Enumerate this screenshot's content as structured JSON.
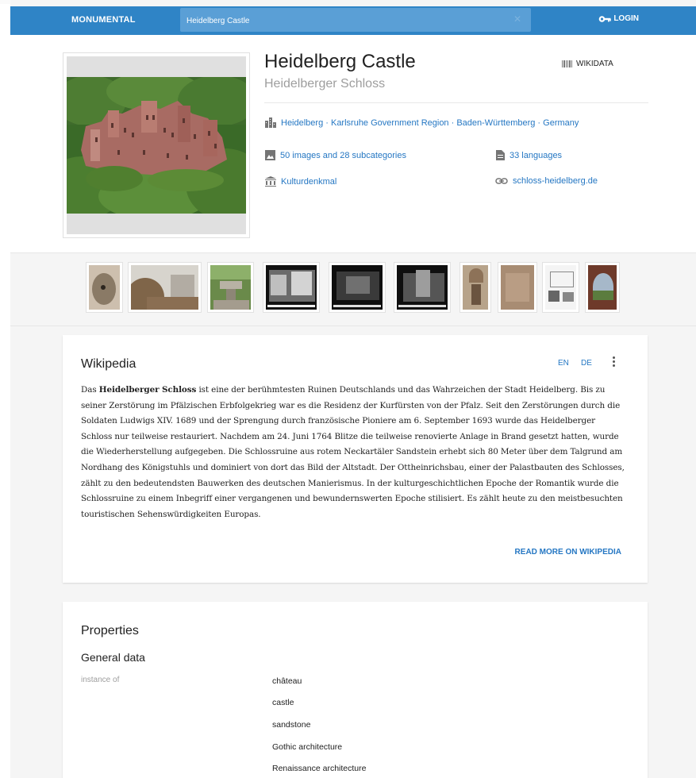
{
  "topbar": {
    "brand": "MONUMENTAL",
    "search_value": "Heidelberg Castle",
    "login_label": "LOGIN"
  },
  "monument": {
    "title": "Heidelberg Castle",
    "subtitle": "Heidelberger Schloss",
    "wikidata_label": "WIKIDATA",
    "location": "Heidelberg · Karlsruhe Government Region · Baden-Württemberg · Germany",
    "images": "50 images and 28 subcategories",
    "languages": "33 languages",
    "heritage": "Kulturdenkmal",
    "website": "schloss-heidelberg.de"
  },
  "thumbnails": [
    "thumb-1",
    "thumb-2",
    "thumb-3",
    "thumb-4",
    "thumb-5",
    "thumb-6",
    "thumb-7",
    "thumb-8",
    "thumb-9",
    "thumb-10"
  ],
  "wikipedia": {
    "title": "Wikipedia",
    "lang_en": "EN",
    "lang_de": "DE",
    "text_bold": "Heidelberger Schloss",
    "text_start": "Das ",
    "text_rest": " ist eine der berühmtesten Ruinen Deutschlands und das Wahrzeichen der Stadt Heidelberg. Bis zu seiner Zerstörung im Pfälzischen Erbfolgekrieg war es die Residenz der Kurfürsten von der Pfalz. Seit den Zerstörungen durch die Soldaten Ludwigs XIV. 1689 und der Sprengung durch französische Pioniere am 6. September 1693 wurde das Heidelberger Schloss nur teilweise restauriert. Nachdem am 24. Juni 1764 Blitze die teilweise renovierte Anlage in Brand gesetzt hatten, wurde die Wiederherstellung aufgegeben. Die Schlossruine aus rotem Neckartäler Sandstein erhebt sich 80 Meter über dem Talgrund am Nordhang des Königstuhls und dominiert von dort das Bild der Altstadt. Der Ottheinrichsbau, einer der Palastbauten des Schlosses, zählt zu den bedeutendsten Bauwerken des deutschen Manierismus. In der kulturgeschichtlichen Epoche der Romantik wurde die Schlossruine zu einem Inbegriff einer vergangenen und bewundernswerten Epoche stilisiert. Es zählt heute zu den meistbesuchten touristischen Sehenswürdigkeiten Europas.",
    "read_more": "READ MORE ON WIKIPEDIA"
  },
  "properties": {
    "title": "Properties",
    "section": "General data",
    "label": "instance of",
    "values": [
      "château",
      "castle",
      "sandstone",
      "Gothic architecture",
      "Renaissance architecture"
    ]
  },
  "colors": {
    "topbar": "#2f84c6",
    "search": "#5a9fd6",
    "link": "#2577c3"
  }
}
